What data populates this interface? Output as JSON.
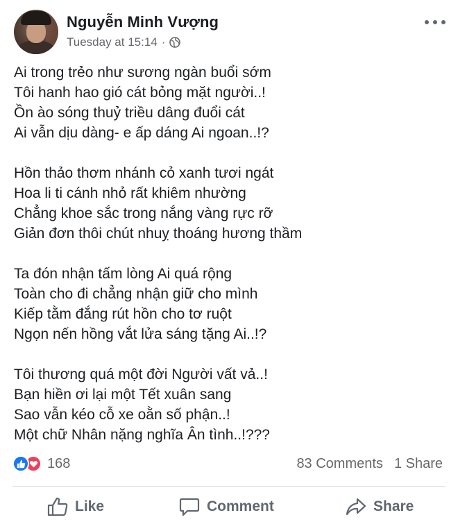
{
  "post": {
    "author": "Nguyễn Minh Vượng",
    "timestamp": "Tuesday at 15:14",
    "separator": "·",
    "poem": [
      [
        "Ai trong trẻo như sương ngàn buổi sớm",
        "Tôi hanh hao gió cát bỏng mặt người..!",
        "Ồn ào sóng thuỷ triều dâng đuổi cát",
        "Ai vẫn dịu dàng- e ấp dáng Ai ngoan..!?"
      ],
      [
        "Hồn thảo thơm nhánh cỏ xanh tươi ngát",
        "Hoa li ti cánh nhỏ rất khiêm nhường",
        "Chẳng khoe sắc trong nắng vàng rực rỡ",
        "Giản đơn thôi chút nhuỵ thoáng hương thầm"
      ],
      [
        "Ta đón nhận tấm lòng Ai quá rộng",
        "Toàn cho đi chẳng nhận giữ cho mình",
        "Kiếp tằm đắng rút hồn cho tơ ruột",
        "Ngọn nến hồng vắt lửa sáng tặng Ai..!?"
      ],
      [
        "Tôi thương quá một đời Người vất vả..!",
        "Bạn hiền ơi lại một Tết xuân sang",
        "Sao vẫn kéo cỗ xe oằn số phận..!",
        "Một chữ Nhân nặng nghĩa Ân tình..!???"
      ]
    ]
  },
  "stats": {
    "reactions": "168",
    "comments": "83 Comments",
    "shares": "1 Share"
  },
  "actions": {
    "like": "Like",
    "comment": "Comment",
    "share": "Share"
  },
  "icons": {
    "privacy": "globe-icon",
    "more": "more-icon",
    "reaction_like": "thumbs-up-icon",
    "reaction_love": "heart-icon"
  },
  "colors": {
    "like_blue": "#1877f2",
    "love_red": "#f33e58",
    "secondary_text": "#65676b"
  }
}
